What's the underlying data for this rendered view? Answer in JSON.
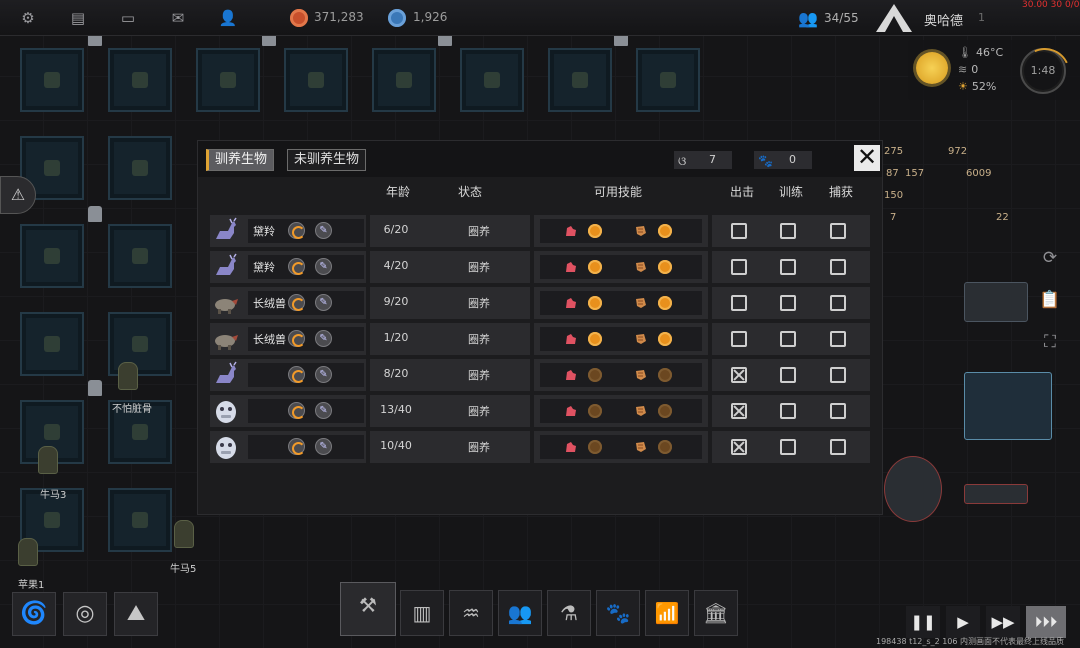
{
  "topbar": {
    "resource1": "371,283",
    "resource2": "1,926",
    "population": "34/55",
    "player_name": "奥哈德",
    "player_level": "1",
    "corner_text": "30.00 30 0/0"
  },
  "weather": {
    "temperature": "46°C",
    "wind": "0",
    "sun": "52%",
    "clock": "1:48"
  },
  "world_labels": {
    "char1": "不怕脏骨",
    "char2": "牛马3",
    "char3": "苹果1",
    "char4": "牛马5",
    "num1": "275",
    "num2": "972",
    "num3": "87",
    "num4": "157",
    "num5": "6009",
    "num6": "150",
    "num7": "7",
    "num8": "22"
  },
  "modal": {
    "tab_tamed": "驯养生物",
    "tab_untamed": "未驯养生物",
    "counter1": "7",
    "counter2": "0",
    "close": "✕",
    "headers": {
      "age": "年龄",
      "status": "状态",
      "skills": "可用技能",
      "deploy": "出击",
      "train": "训练",
      "capture": "捕获"
    },
    "rows": [
      {
        "name": "黛羚",
        "species": "deer",
        "age": "6/20",
        "status": "圈养",
        "skill1": "on",
        "skill2": "on",
        "deploy": false,
        "train": false,
        "capture": false
      },
      {
        "name": "黛羚",
        "species": "deer",
        "age": "4/20",
        "status": "圈养",
        "skill1": "on",
        "skill2": "on",
        "deploy": false,
        "train": false,
        "capture": false
      },
      {
        "name": "长绒兽",
        "species": "boar",
        "age": "9/20",
        "status": "圈养",
        "skill1": "on",
        "skill2": "on",
        "deploy": false,
        "train": false,
        "capture": false
      },
      {
        "name": "长绒兽",
        "species": "boar",
        "age": "1/20",
        "status": "圈养",
        "skill1": "on",
        "skill2": "on",
        "deploy": false,
        "train": false,
        "capture": false
      },
      {
        "name": "",
        "species": "deer",
        "age": "8/20",
        "status": "圈养",
        "skill1": "off",
        "skill2": "off",
        "deploy": true,
        "train": false,
        "capture": false
      },
      {
        "name": "",
        "species": "yeti",
        "age": "13/40",
        "status": "圈养",
        "skill1": "off",
        "skill2": "off",
        "deploy": true,
        "train": false,
        "capture": false
      },
      {
        "name": "",
        "species": "yeti",
        "age": "10/40",
        "status": "圈养",
        "skill1": "off",
        "skill2": "off",
        "deploy": true,
        "train": false,
        "capture": false
      }
    ]
  },
  "version_text": "198438 t12_s_2 106 内测画面不代表最终上线品质",
  "icons": [
    "gear-icon",
    "chat-icon",
    "message-icon",
    "mail-icon",
    "user-icon",
    "alert-icon",
    "build-icon",
    "pause-icon",
    "play-icon",
    "fast-forward-icon"
  ]
}
